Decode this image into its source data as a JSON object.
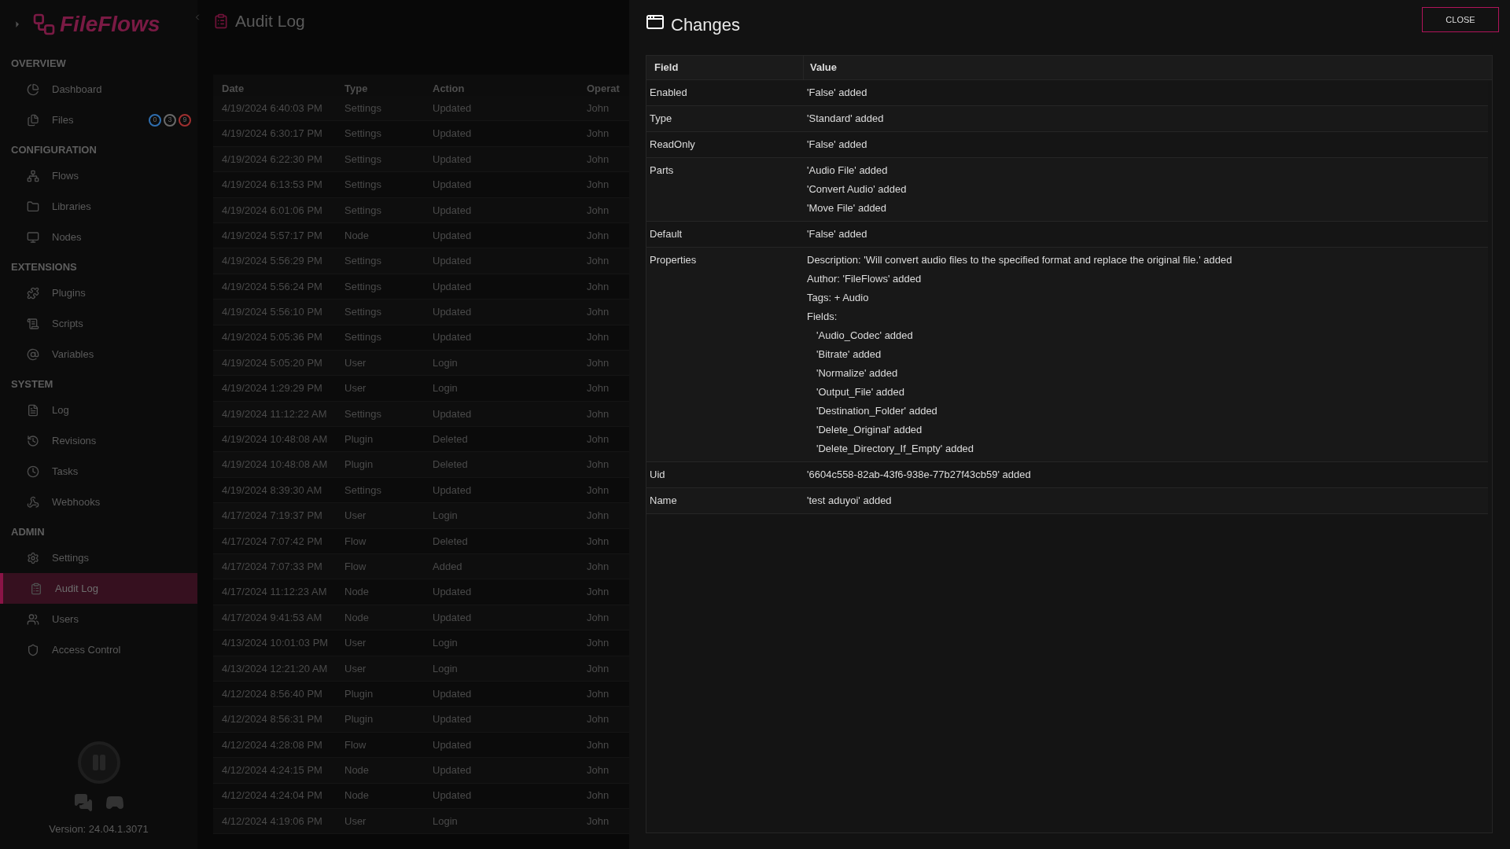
{
  "sidebar": {
    "logo": "FileFlows",
    "sections": [
      {
        "title": "OVERVIEW",
        "items": [
          {
            "label": "Dashboard",
            "selected": false
          },
          {
            "label": "Files",
            "selected": false,
            "badges": [
              {
                "text": "0",
                "color": "#2f6fb0"
              },
              {
                "text": "3",
                "color": "#6a6a6a"
              },
              {
                "text": "9",
                "color": "#a03030"
              }
            ]
          }
        ]
      },
      {
        "title": "CONFIGURATION",
        "items": [
          {
            "label": "Flows",
            "selected": false
          },
          {
            "label": "Libraries",
            "selected": false
          },
          {
            "label": "Nodes",
            "selected": false
          }
        ]
      },
      {
        "title": "EXTENSIONS",
        "items": [
          {
            "label": "Plugins",
            "selected": false
          },
          {
            "label": "Scripts",
            "selected": false
          },
          {
            "label": "Variables",
            "selected": false
          }
        ]
      },
      {
        "title": "SYSTEM",
        "items": [
          {
            "label": "Log",
            "selected": false
          },
          {
            "label": "Revisions",
            "selected": false
          },
          {
            "label": "Tasks",
            "selected": false
          },
          {
            "label": "Webhooks",
            "selected": false
          }
        ]
      },
      {
        "title": "ADMIN",
        "items": [
          {
            "label": "Settings",
            "selected": false
          },
          {
            "label": "Audit Log",
            "selected": true
          },
          {
            "label": "Users",
            "selected": false
          },
          {
            "label": "Access Control",
            "selected": false
          }
        ]
      }
    ],
    "version": "Version: 24.04.1.3071"
  },
  "page": {
    "title": "Audit Log",
    "columns": [
      "Date",
      "Type",
      "Action",
      "Operat"
    ],
    "rows": [
      [
        "4/19/2024 6:40:03 PM",
        "Settings",
        "Updated",
        "John"
      ],
      [
        "4/19/2024 6:30:17 PM",
        "Settings",
        "Updated",
        "John"
      ],
      [
        "4/19/2024 6:22:30 PM",
        "Settings",
        "Updated",
        "John"
      ],
      [
        "4/19/2024 6:13:53 PM",
        "Settings",
        "Updated",
        "John"
      ],
      [
        "4/19/2024 6:01:06 PM",
        "Settings",
        "Updated",
        "John"
      ],
      [
        "4/19/2024 5:57:17 PM",
        "Node",
        "Updated",
        "John"
      ],
      [
        "4/19/2024 5:56:29 PM",
        "Settings",
        "Updated",
        "John"
      ],
      [
        "4/19/2024 5:56:24 PM",
        "Settings",
        "Updated",
        "John"
      ],
      [
        "4/19/2024 5:56:10 PM",
        "Settings",
        "Updated",
        "John"
      ],
      [
        "4/19/2024 5:05:36 PM",
        "Settings",
        "Updated",
        "John"
      ],
      [
        "4/19/2024 5:05:20 PM",
        "User",
        "Login",
        "John"
      ],
      [
        "4/19/2024 1:29:29 PM",
        "User",
        "Login",
        "John"
      ],
      [
        "4/19/2024 11:12:22 AM",
        "Settings",
        "Updated",
        "John"
      ],
      [
        "4/19/2024 10:48:08 AM",
        "Plugin",
        "Deleted",
        "John"
      ],
      [
        "4/19/2024 10:48:08 AM",
        "Plugin",
        "Deleted",
        "John"
      ],
      [
        "4/19/2024 8:39:30 AM",
        "Settings",
        "Updated",
        "John"
      ],
      [
        "4/17/2024 7:19:37 PM",
        "User",
        "Login",
        "John"
      ],
      [
        "4/17/2024 7:07:42 PM",
        "Flow",
        "Deleted",
        "John"
      ],
      [
        "4/17/2024 7:07:33 PM",
        "Flow",
        "Added",
        "John"
      ],
      [
        "4/17/2024 11:12:23 AM",
        "Node",
        "Updated",
        "John"
      ],
      [
        "4/17/2024 9:41:53 AM",
        "Node",
        "Updated",
        "John"
      ],
      [
        "4/13/2024 10:01:03 PM",
        "User",
        "Login",
        "John"
      ],
      [
        "4/13/2024 12:21:20 AM",
        "User",
        "Login",
        "John"
      ],
      [
        "4/12/2024 8:56:40 PM",
        "Plugin",
        "Updated",
        "John"
      ],
      [
        "4/12/2024 8:56:31 PM",
        "Plugin",
        "Updated",
        "John"
      ],
      [
        "4/12/2024 4:28:08 PM",
        "Flow",
        "Updated",
        "John"
      ],
      [
        "4/12/2024 4:24:15 PM",
        "Node",
        "Updated",
        "John"
      ],
      [
        "4/12/2024 4:24:04 PM",
        "Node",
        "Updated",
        "John"
      ],
      [
        "4/12/2024 4:19:06 PM",
        "User",
        "Login",
        "John"
      ]
    ]
  },
  "dialog": {
    "title": "Changes",
    "close": "CLOSE",
    "columns": [
      "Field",
      "Value"
    ],
    "rows": [
      {
        "field": "Enabled",
        "lines": [
          {
            "text": "'False' added"
          }
        ]
      },
      {
        "field": "Type",
        "lines": [
          {
            "text": "'Standard' added"
          }
        ]
      },
      {
        "field": "ReadOnly",
        "lines": [
          {
            "text": "'False' added"
          }
        ]
      },
      {
        "field": "Parts",
        "lines": [
          {
            "text": "'Audio File' added"
          },
          {
            "text": "'Convert Audio' added"
          },
          {
            "text": "'Move File' added"
          }
        ]
      },
      {
        "field": "Default",
        "lines": [
          {
            "text": "'False' added"
          }
        ]
      },
      {
        "field": "Properties",
        "lines": [
          {
            "text": "Description: 'Will convert audio files to the specified format and replace the original file.' added"
          },
          {
            "text": "Author: 'FileFlows' added"
          },
          {
            "text": "Tags: + Audio"
          },
          {
            "text": "Fields:",
            "children": [
              {
                "text": "'Audio_Codec' added"
              },
              {
                "text": "'Bitrate' added"
              },
              {
                "text": "'Normalize' added"
              },
              {
                "text": "'Output_File' added"
              },
              {
                "text": "'Destination_Folder' added"
              },
              {
                "text": "'Delete_Original' added"
              },
              {
                "text": "'Delete_Directory_If_Empty' added"
              }
            ]
          }
        ]
      },
      {
        "field": "Uid",
        "lines": [
          {
            "text": "'6604c558-82ab-43f6-938e-77b27f43cb59' added"
          }
        ]
      },
      {
        "field": "Name",
        "lines": [
          {
            "text": "'test aduyoi' added"
          }
        ]
      }
    ]
  }
}
